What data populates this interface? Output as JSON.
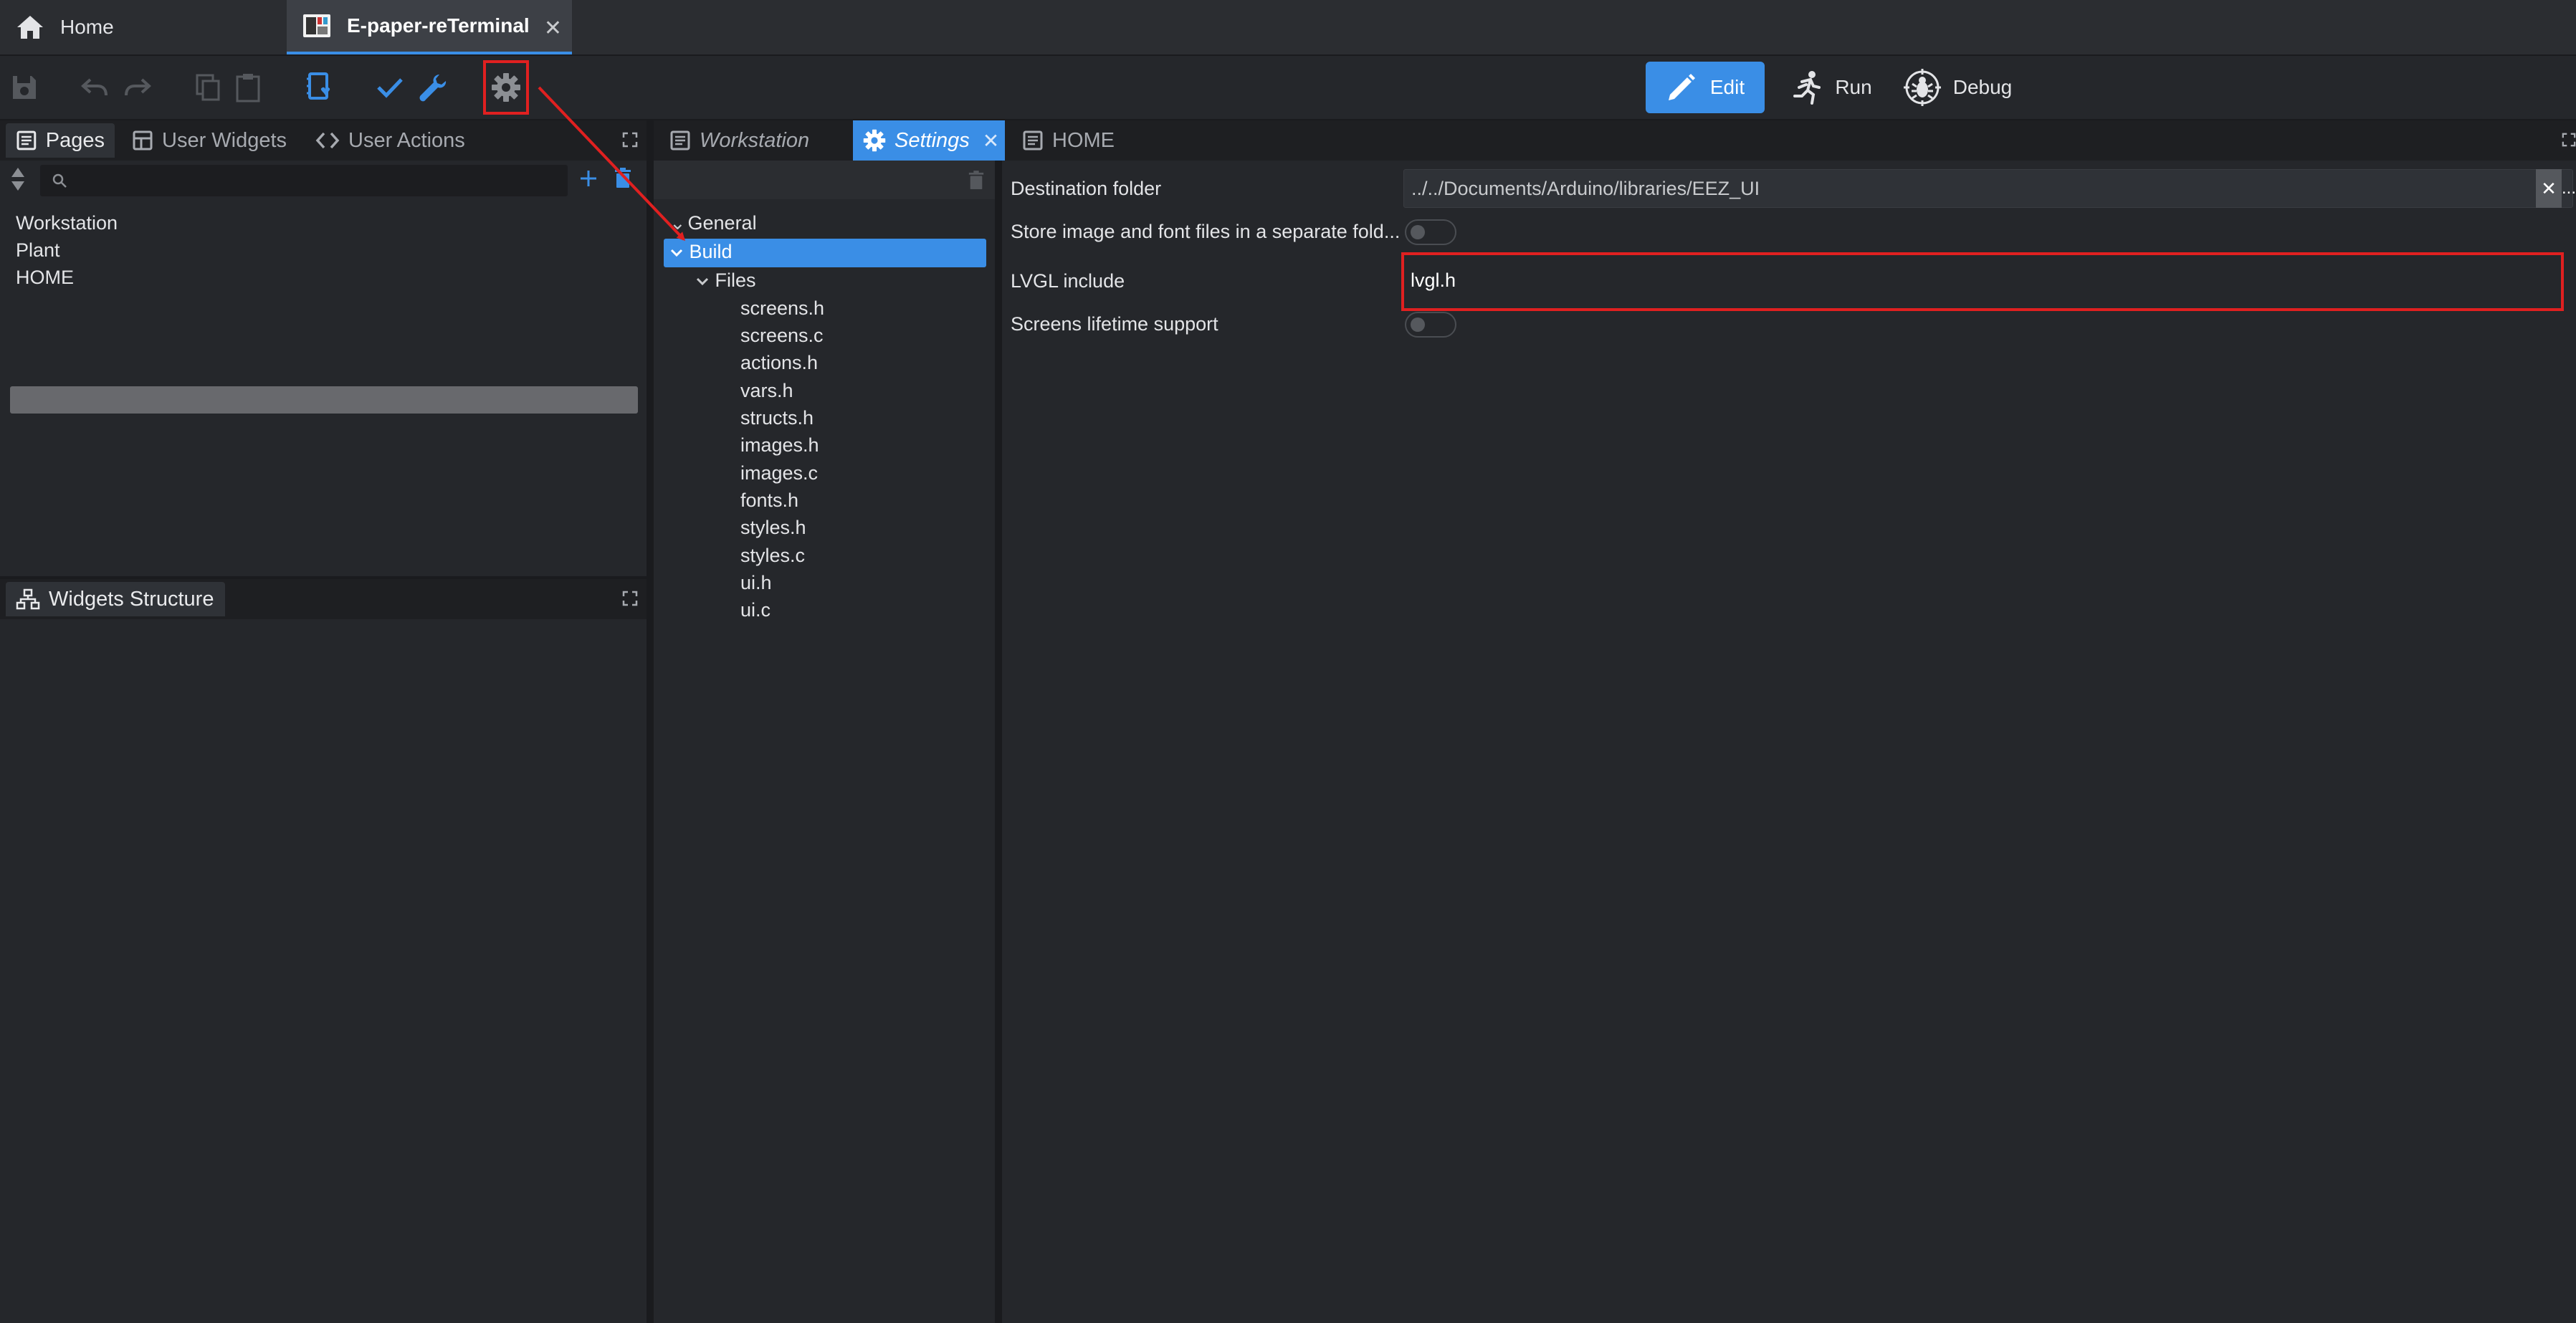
{
  "tabs": {
    "home_label": "Home",
    "project_label": "E-paper-reTerminal"
  },
  "modes": {
    "edit": "Edit",
    "run": "Run",
    "debug": "Debug"
  },
  "left_panel": {
    "tabs": [
      "Pages",
      "User Widgets",
      "User Actions"
    ],
    "pages": [
      "Workstation",
      "Plant",
      "HOME"
    ],
    "selected_page": "HOME",
    "structure_tab": "Widgets Structure"
  },
  "editor_tabs": [
    "Workstation",
    "Settings",
    "HOME"
  ],
  "active_editor_tab": "Settings",
  "settings_tree": {
    "general": "General",
    "build": "Build",
    "files": "Files",
    "file_list": [
      "screens.h",
      "screens.c",
      "actions.h",
      "vars.h",
      "structs.h",
      "images.h",
      "images.c",
      "fonts.h",
      "styles.h",
      "styles.c",
      "ui.h",
      "ui.c"
    ]
  },
  "properties": {
    "destination_folder_label": "Destination folder",
    "destination_folder_value": "../../Documents/Arduino/libraries/EEZ_UI",
    "separate_folder_label": "Store image and font files in a separate fold...",
    "separate_folder_on": false,
    "lvgl_include_label": "LVGL include",
    "lvgl_include_value": "lvgl.h",
    "lifetime_label": "Screens lifetime support",
    "lifetime_on": false,
    "clear_symbol": "✕",
    "more_symbol": "..."
  },
  "colors": {
    "accent": "#3a8ee6",
    "annotation": "#e02020"
  }
}
